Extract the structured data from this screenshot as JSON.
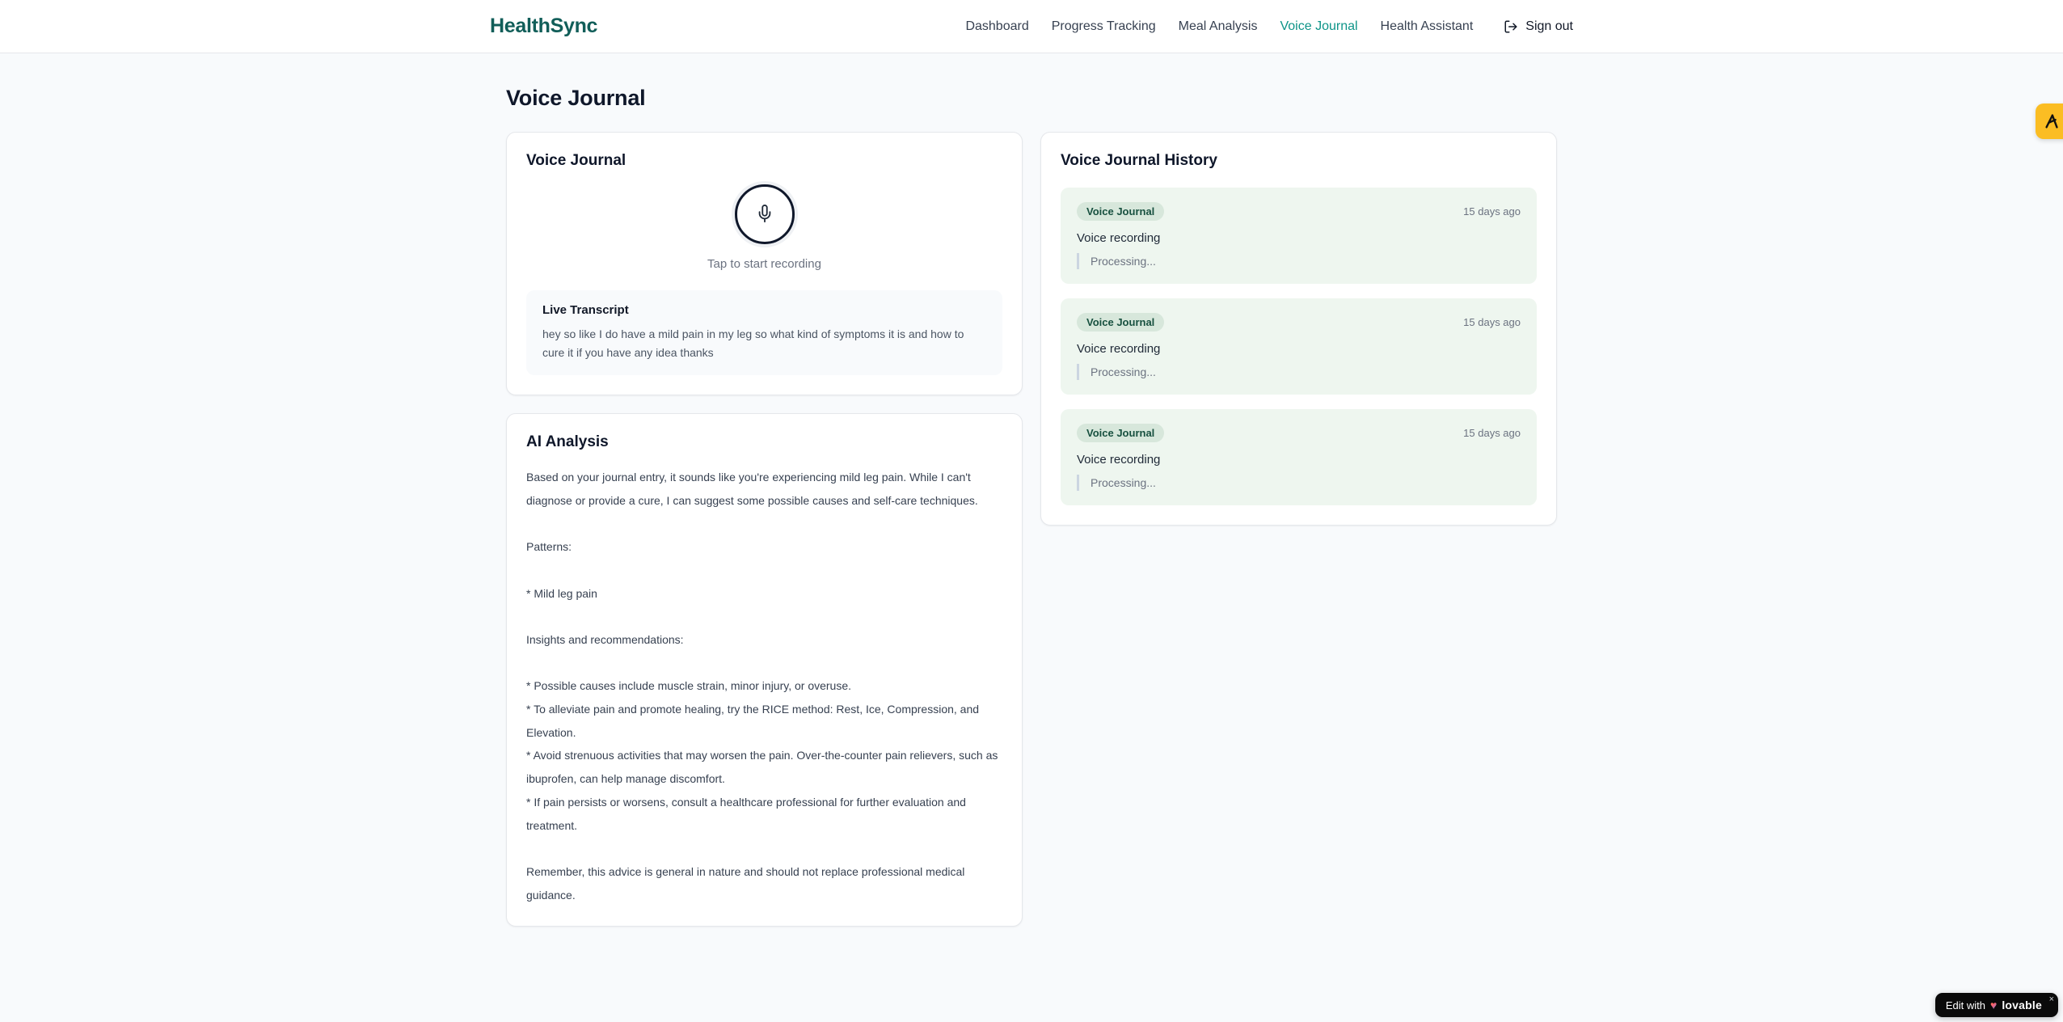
{
  "brand": {
    "name": "HealthSync"
  },
  "nav": {
    "items": [
      {
        "label": "Dashboard",
        "active": false
      },
      {
        "label": "Progress Tracking",
        "active": false
      },
      {
        "label": "Meal Analysis",
        "active": false
      },
      {
        "label": "Voice Journal",
        "active": true
      },
      {
        "label": "Health Assistant",
        "active": false
      }
    ],
    "sign_out": "Sign out"
  },
  "page": {
    "title": "Voice Journal"
  },
  "recorder": {
    "card_title": "Voice Journal",
    "tap_hint": "Tap to start recording",
    "transcript": {
      "title": "Live Transcript",
      "text": "hey so like I do have a mild pain in my leg so what kind of symptoms it is and how to cure it if you have any idea thanks"
    }
  },
  "analysis": {
    "card_title": "AI Analysis",
    "body": "Based on your journal entry, it sounds like you're experiencing mild leg pain. While I can't diagnose or provide a cure, I can suggest some possible causes and self-care techniques.\n\nPatterns:\n\n* Mild leg pain\n\nInsights and recommendations:\n\n* Possible causes include muscle strain, minor injury, or overuse.\n* To alleviate pain and promote healing, try the RICE method: Rest, Ice, Compression, and Elevation.\n* Avoid strenuous activities that may worsen the pain. Over-the-counter pain relievers, such as ibuprofen, can help manage discomfort.\n* If pain persists or worsens, consult a healthcare professional for further evaluation and treatment.\n\nRemember, this advice is general in nature and should not replace professional medical guidance."
  },
  "history": {
    "card_title": "Voice Journal History",
    "entries": [
      {
        "badge": "Voice Journal",
        "time": "15 days ago",
        "title": "Voice recording",
        "status": "Processing..."
      },
      {
        "badge": "Voice Journal",
        "time": "15 days ago",
        "title": "Voice recording",
        "status": "Processing..."
      },
      {
        "badge": "Voice Journal",
        "time": "15 days ago",
        "title": "Voice recording",
        "status": "Processing..."
      }
    ]
  },
  "overlays": {
    "lovable": {
      "prefix": "Edit with",
      "heart": "♥",
      "brand": "lovable",
      "close": "×"
    }
  },
  "colors": {
    "brand_teal": "#115e59",
    "nav_active_teal": "#0d9488",
    "page_bg": "#f8fafc",
    "history_item_bg": "#eef6ef",
    "badge_bg": "#d7e7db",
    "badge_text": "#17503f",
    "feedback_tab_amber": "#fbbd23",
    "lovable_pill_bg": "#0a0a0a"
  }
}
